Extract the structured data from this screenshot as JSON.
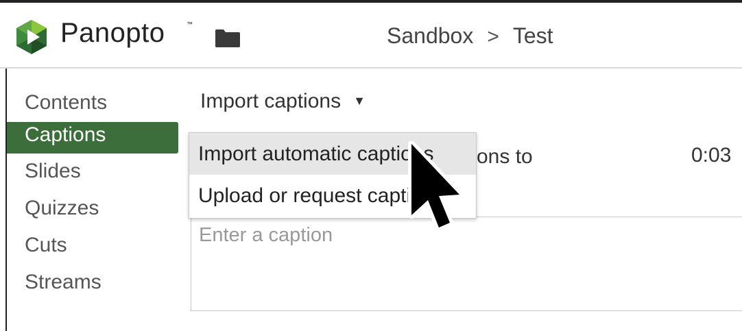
{
  "header": {
    "brand": "Panopto",
    "trademark": "™",
    "breadcrumb": {
      "parent": "Sandbox",
      "separator": ">",
      "current": "Test"
    }
  },
  "sidebar": {
    "items": [
      {
        "label": "Contents",
        "active": false
      },
      {
        "label": "Captions",
        "active": true
      },
      {
        "label": "Slides",
        "active": false
      },
      {
        "label": "Quizzes",
        "active": false
      },
      {
        "label": "Cuts",
        "active": false
      },
      {
        "label": "Streams",
        "active": false
      }
    ]
  },
  "toolbar": {
    "import_label": "Import captions",
    "caret": "▼"
  },
  "dropdown": {
    "items": [
      {
        "label": "Import automatic captions",
        "hovered": true
      },
      {
        "label": "Upload or request captions",
        "hovered": false
      }
    ]
  },
  "obscured": {
    "partial_text": "tions to",
    "timestamp": "0:03"
  },
  "caption_input": {
    "placeholder": "Enter a caption"
  },
  "colors": {
    "accent": "#3c6e3c",
    "logo_green_light": "#8cc63f",
    "logo_green_dark": "#2e6b34"
  },
  "icons": {
    "logo": "panopto-logo-icon",
    "folder": "folder-icon",
    "cursor": "mouse-pointer-icon"
  }
}
